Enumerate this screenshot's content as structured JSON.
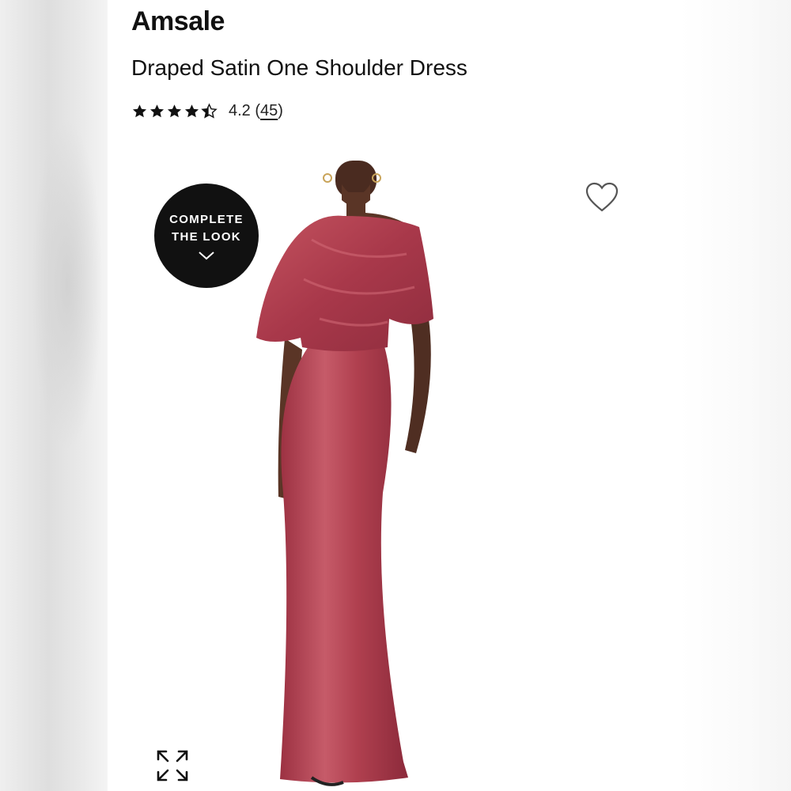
{
  "product": {
    "brand": "Amsale",
    "name": "Draped Satin One Shoulder Dress",
    "rating": {
      "value": "4.2",
      "open_paren": "(",
      "count": "45",
      "close_paren": ")",
      "stars_out_of_5": 4.2
    }
  },
  "gallery": {
    "complete_look": {
      "line1": "COMPLETE",
      "line2": "THE LOOK",
      "icon": "chevron-down-icon"
    },
    "wishlist_icon": "heart-outline-icon",
    "expand_icon": "expand-arrows-icon",
    "image_description_color": "#B3404F"
  },
  "colors": {
    "text": "#111111",
    "badge_background": "#111111",
    "badge_text": "#FFFFFF",
    "dress": "#B3404F",
    "skin": "#5A3526"
  }
}
